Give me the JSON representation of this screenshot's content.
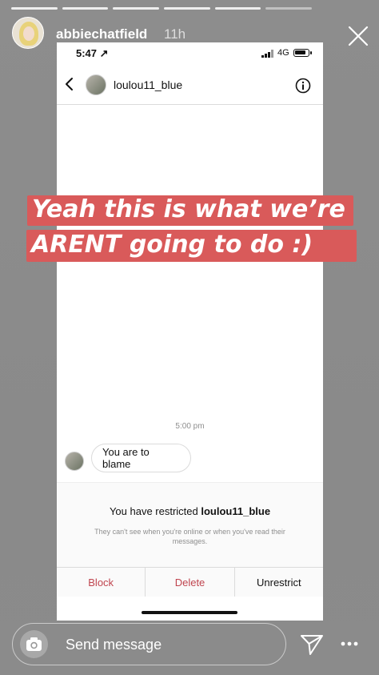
{
  "story": {
    "username": "abbiechatfield",
    "time_ago": "11h",
    "progress_segments": 6,
    "current_segment": 5
  },
  "status_bar": {
    "clock": "5:47 ↗",
    "network": "4G"
  },
  "dm": {
    "contact_name": "loulou11_blue",
    "timestamp": "5:00 pm",
    "message": "You are to blame",
    "restrict_prefix": "You have restricted ",
    "restrict_name": "loulou11_blue",
    "restrict_note": "They can't see when you're online or when you've read their messages.",
    "actions": {
      "block": "Block",
      "delete": "Delete",
      "unrestrict": "Unrestrict"
    }
  },
  "caption": {
    "line1": "Yeah this is what we’re",
    "line2": "ARENT going to do :)"
  },
  "reply": {
    "placeholder": "Send message"
  },
  "colors": {
    "caption_bg": "#d95a5a",
    "action_red": "#c0454f"
  }
}
